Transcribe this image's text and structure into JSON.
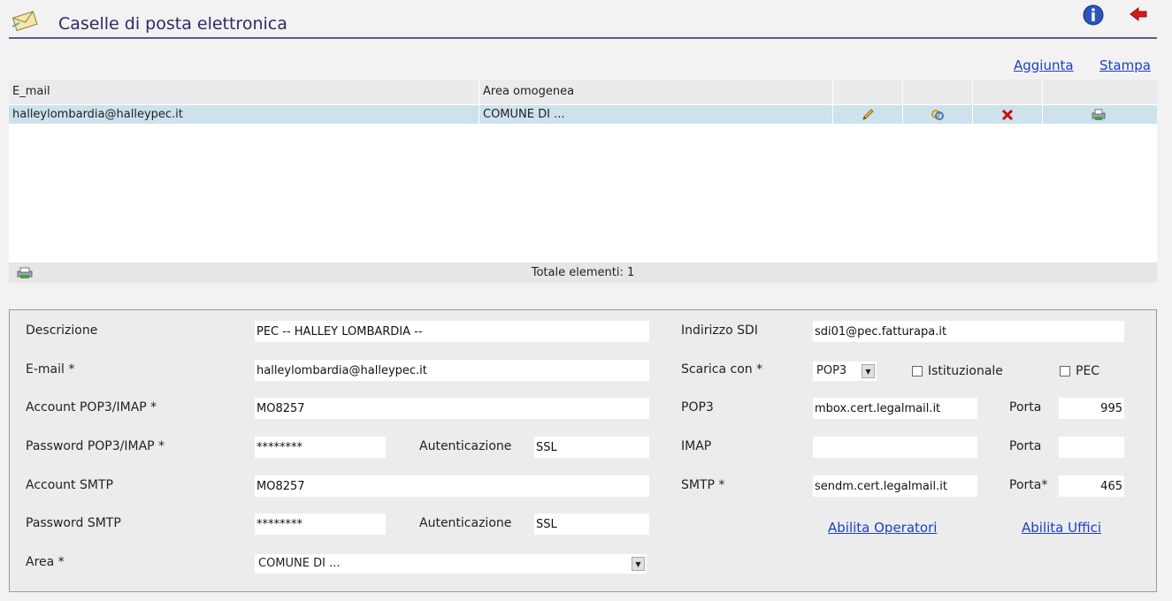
{
  "header": {
    "title": "Caselle di posta elettronica",
    "mail_icon": "envelope-icon",
    "info_icon": "info-icon",
    "back_icon": "back-arrow-icon"
  },
  "links": {
    "add": "Aggiunta",
    "print": "Stampa"
  },
  "grid": {
    "columns": [
      "E_mail",
      "Area omogenea"
    ],
    "rows": [
      {
        "email": "halleylombardia@halleypec.it",
        "area": "COMUNE DI ...",
        "icons": [
          "pencil-icon",
          "link-icon",
          "delete-icon",
          "print-icon"
        ]
      }
    ],
    "footer_total": "Totale elementi: 1",
    "footer_icon": "print-icon"
  },
  "form": {
    "descrizione": {
      "label": "Descrizione",
      "value": "PEC -- HALLEY LOMBARDIA --"
    },
    "email": {
      "label": "E-mail  *",
      "value": "halleylombardia@halleypec.it"
    },
    "account_pop": {
      "label": "Account POP3/IMAP  *",
      "value": "MO8257"
    },
    "password_pop": {
      "label": "Password POP3/IMAP  *",
      "value": "********"
    },
    "auth1": {
      "label": "Autenticazione",
      "value": "SSL"
    },
    "account_smtp": {
      "label": "Account SMTP",
      "value": "MO8257"
    },
    "password_smtp": {
      "label": "Password SMTP",
      "value": "********"
    },
    "auth2": {
      "label": "Autenticazione",
      "value": "SSL"
    },
    "area": {
      "label": "Area  *",
      "value": "COMUNE DI ..."
    },
    "sdi": {
      "label": "Indirizzo SDI",
      "value": "sdi01@pec.fatturapa.it"
    },
    "scarica": {
      "label": "Scarica con  *",
      "value": "POP3"
    },
    "istituzionale": {
      "label": "Istituzionale",
      "checked": false
    },
    "pec": {
      "label": "PEC",
      "checked": false
    },
    "pop3": {
      "label": "POP3",
      "value": "mbox.cert.legalmail.it",
      "port_label": "Porta",
      "port": "995"
    },
    "imap": {
      "label": "IMAP",
      "value": "",
      "port_label": "Porta",
      "port": ""
    },
    "smtp": {
      "label": "SMTP  *",
      "value": "sendm.cert.legalmail.it",
      "port_label": "Porta*",
      "port": "465"
    },
    "abilita_operatori": "Abilita Operatori",
    "abilita_uffici": "Abilita Uffici"
  }
}
